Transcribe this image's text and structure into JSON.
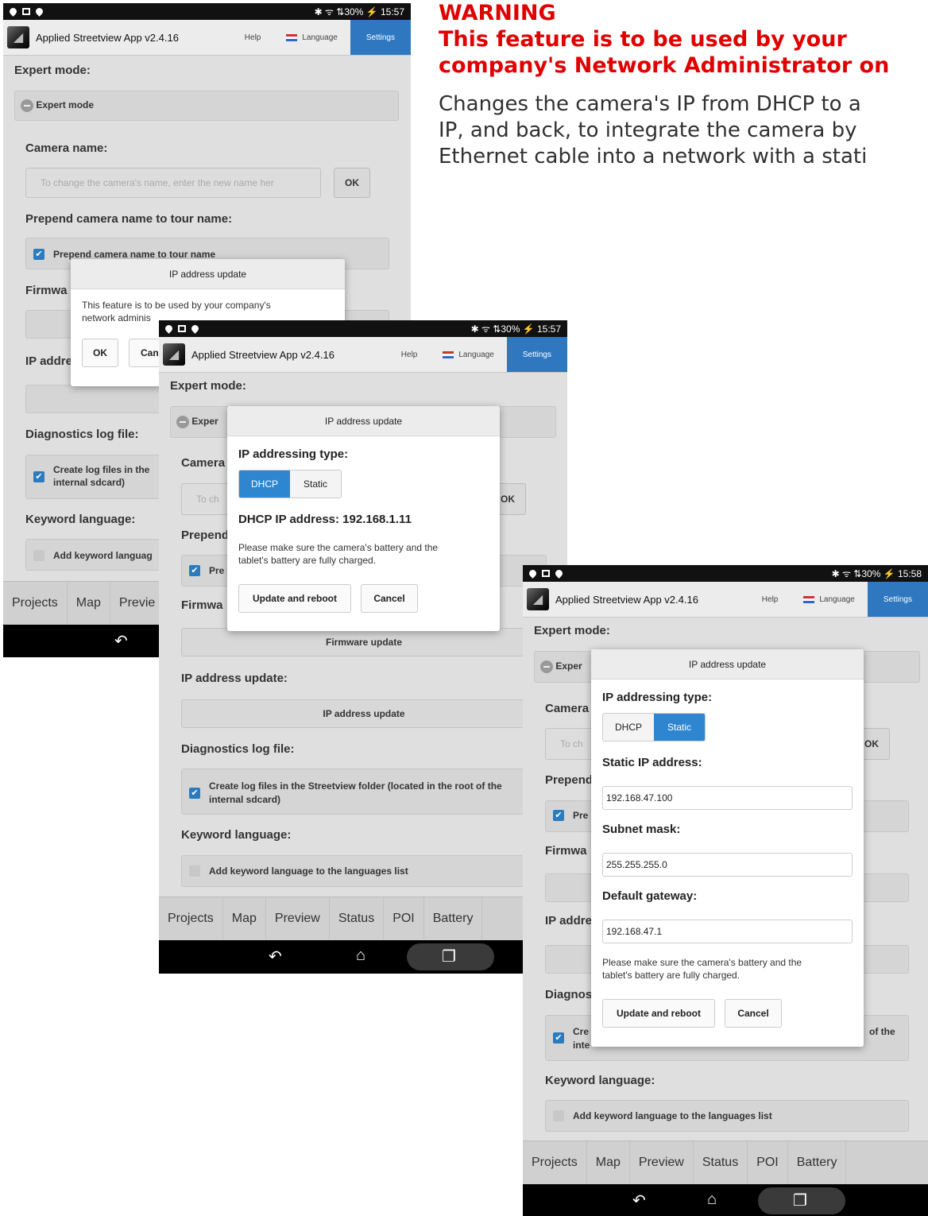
{
  "warning": {
    "title": "WARNING",
    "line1": "This feature is to be used by your",
    "line2": "company's Network Administrator on",
    "body1": "Changes the camera's IP from DHCP to a",
    "body2": "IP, and back, to integrate the camera by",
    "body3": "Ethernet cable into a network with a stati"
  },
  "shot1": {
    "status_right": "✱ ᯤ ⇅30% ⚡ 15:57",
    "app_title": "Applied Streetview App v2.4.16",
    "tab_help": "Help",
    "tab_language": "Language",
    "tab_settings": "Settings",
    "expert_mode_heading": "Expert mode:",
    "expert_mode_toggle": "Expert mode",
    "camera_name_heading": "Camera name:",
    "camera_name_placeholder": "To change the camera's name, enter the new name her",
    "ok": "OK",
    "prepend_heading": "Prepend camera name to tour name:",
    "prepend_checkbox": "Prepend camera name to tour name",
    "firmware_heading": "Firmwa",
    "ip_heading": "IP addre",
    "diag_heading": "Diagnostics log file:",
    "diag_checkbox_l1": "Create log files in the",
    "diag_checkbox_l2": "internal sdcard)",
    "keyword_heading": "Keyword language:",
    "keyword_checkbox": "Add keyword languag",
    "nav_projects": "Projects",
    "nav_map": "Map",
    "nav_preview": "Previe",
    "back_key": "↶",
    "dialog_title": "IP address update",
    "dialog_text_l1": "This feature is to be used by your company's",
    "dialog_text_l2": "network adminis",
    "dialog_ok": "OK",
    "dialog_cancel": "Can"
  },
  "shot2": {
    "status_right": "✱ ᯤ ⇅30% ⚡ 15:57",
    "app_title": "Applied Streetview App v2.4.16",
    "tab_help": "Help",
    "tab_language": "Language",
    "tab_settings": "Settings",
    "expert_mode_heading": "Expert mode:",
    "expert_mode_toggle": "Exper",
    "camera_heading": "Camera",
    "camera_placeholder": "To ch",
    "ok": "OK",
    "prepend_heading": "Prepend",
    "prepend_checkbox": "Pre",
    "firmware_heading": "Firmwa",
    "firmware_button": "Firmware update",
    "ip_heading": "IP address update:",
    "ip_button": "IP address update",
    "diag_heading": "Diagnostics log file:",
    "diag_checkbox_l1": "Create log files in the Streetview folder (located in the root of the",
    "diag_checkbox_l2": "internal sdcard)",
    "keyword_heading": "Keyword language:",
    "keyword_checkbox": "Add keyword language to the languages list",
    "nav": [
      "Projects",
      "Map",
      "Preview",
      "Status",
      "POI",
      "Battery"
    ],
    "dialog_title": "IP address update",
    "dialog_type_label": "IP addressing type:",
    "dialog_dhcp": "DHCP",
    "dialog_static": "Static",
    "dialog_dhcp_ip": "DHCP IP address: 192.168.1.11",
    "dialog_note_l1": "Please make sure the camera's battery and the",
    "dialog_note_l2": "tablet's battery are fully charged.",
    "dialog_update": "Update and reboot",
    "dialog_cancel": "Cancel"
  },
  "shot3": {
    "status_right": "✱ ᯤ ⇅30% ⚡ 15:58",
    "app_title": "Applied Streetview App v2.4.16",
    "tab_help": "Help",
    "tab_language": "Language",
    "tab_settings": "Settings",
    "expert_mode_heading": "Expert mode:",
    "expert_mode_toggle": "Exper",
    "camera_heading": "Camera",
    "camera_placeholder": "To ch",
    "ok": "OK",
    "prepend_heading": "Prepend",
    "prepend_checkbox": "Pre",
    "firmware_heading": "Firmwa",
    "ip_heading": "IP addre",
    "diag_heading": "Diagnos",
    "diag_checkbox_l1": "Cre",
    "diag_checkbox_l1_right": "of the",
    "diag_checkbox_l2": "inte",
    "keyword_heading": "Keyword language:",
    "keyword_checkbox": "Add keyword language to the languages list",
    "nav": [
      "Projects",
      "Map",
      "Preview",
      "Status",
      "POI",
      "Battery"
    ],
    "dialog_title": "IP address update",
    "dialog_type_label": "IP addressing type:",
    "dialog_dhcp": "DHCP",
    "dialog_static": "Static",
    "static_ip_label": "Static IP address:",
    "static_ip_value": "192.168.47.100",
    "subnet_label": "Subnet mask:",
    "subnet_value": "255.255.255.0",
    "gateway_label": "Default gateway:",
    "gateway_value": "192.168.47.1",
    "dialog_note_l1": "Please make sure the camera's battery and the",
    "dialog_note_l2": "tablet's battery are fully charged.",
    "dialog_update": "Update and reboot",
    "dialog_cancel": "Cancel"
  }
}
